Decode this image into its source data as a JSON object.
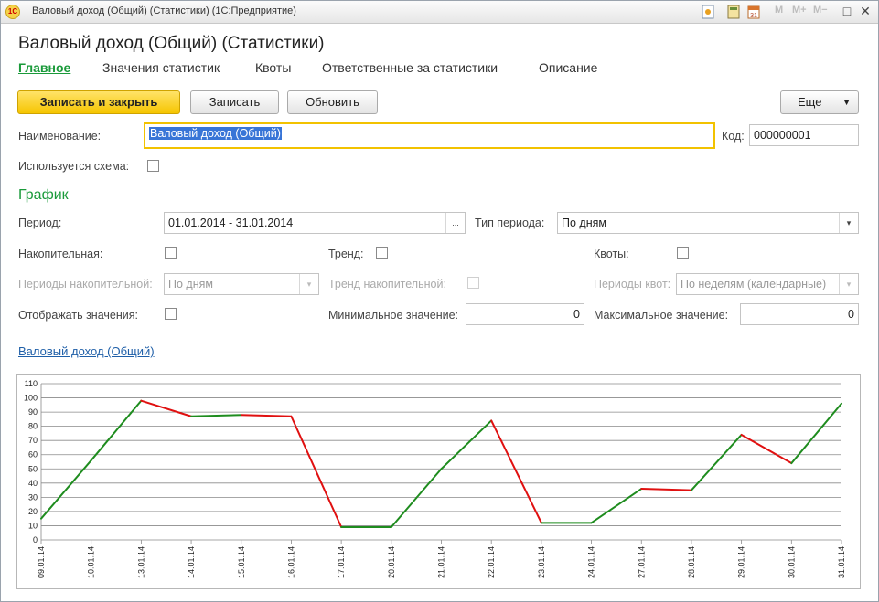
{
  "window": {
    "title": "Валовый доход (Общий) (Статистики)  (1С:Предприятие)",
    "toolbar_m": [
      "M",
      "M+",
      "M−"
    ]
  },
  "form": {
    "title": "Валовый доход (Общий) (Статистики)",
    "tabs": [
      {
        "label": "Главное"
      },
      {
        "label": "Значения статистик"
      },
      {
        "label": "Квоты"
      },
      {
        "label": "Ответственные за статистики"
      },
      {
        "label": "Описание"
      }
    ],
    "buttons": {
      "save_close": "Записать и закрыть",
      "save": "Записать",
      "refresh": "Обновить",
      "more": "Еще"
    },
    "name": {
      "label": "Наименование:",
      "value": "Валовый доход (Общий)"
    },
    "code": {
      "label": "Код:",
      "value": "000000001"
    },
    "uses_schema": {
      "label": "Используется схема:",
      "checked": false
    },
    "section_title": "График",
    "period": {
      "label": "Период:",
      "value": "01.01.2014 - 31.01.2014",
      "button": "..."
    },
    "period_type": {
      "label": "Тип периода:",
      "value": "По дням"
    },
    "cumulative": {
      "label": "Накопительная:",
      "checked": false
    },
    "trend": {
      "label": "Тренд:",
      "checked": false
    },
    "quotas": {
      "label": "Квоты:",
      "checked": false
    },
    "cumulative_periods": {
      "label": "Периоды накопительной:",
      "value": "По дням"
    },
    "trend_cumulative": {
      "label": "Тренд накопительной:",
      "checked": false
    },
    "quota_periods": {
      "label": "Периоды квот:",
      "value": "По неделям (календарные)"
    },
    "show_values": {
      "label": "Отображать значения:",
      "checked": false
    },
    "min_value": {
      "label": "Минимальное значение:",
      "value": "0"
    },
    "max_value": {
      "label": "Максимальное значение:",
      "value": "0"
    },
    "chart_link": "Валовый доход (Общий)"
  },
  "colors": {
    "up": "#1e8c1e",
    "down": "#e01010",
    "accent": "#1a9a3a"
  },
  "chart_data": {
    "type": "line",
    "categories": [
      "09.01.14",
      "10.01.14",
      "13.01.14",
      "14.01.14",
      "15.01.14",
      "16.01.14",
      "17.01.14",
      "20.01.14",
      "21.01.14",
      "22.01.14",
      "23.01.14",
      "24.01.14",
      "27.01.14",
      "28.01.14",
      "29.01.14",
      "30.01.14",
      "31.01.14"
    ],
    "values": [
      15,
      56,
      98,
      87,
      88,
      87,
      9,
      9,
      50,
      84,
      12,
      12,
      36,
      35,
      74,
      54,
      96
    ],
    "yticks": [
      0,
      10,
      20,
      30,
      40,
      50,
      60,
      70,
      80,
      90,
      100,
      110
    ],
    "ylim": [
      0,
      110
    ],
    "grid": true,
    "note": "segment colored green when value rises, red when it falls"
  }
}
